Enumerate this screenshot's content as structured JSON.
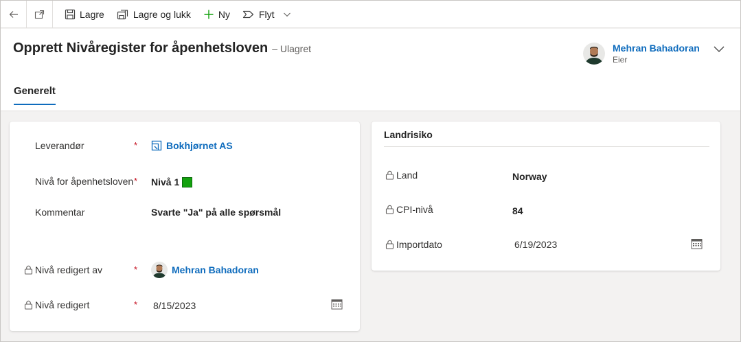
{
  "toolbar": {
    "save_label": "Lagre",
    "save_close_label": "Lagre og lukk",
    "new_label": "Ny",
    "flow_label": "Flyt"
  },
  "header": {
    "title": "Opprett Nivåregister for åpenhetsloven",
    "status": "– Ulagret",
    "owner_name": "Mehran Bahadoran",
    "owner_role": "Eier"
  },
  "tabs": [
    {
      "label": "Generelt",
      "active": true
    }
  ],
  "general": {
    "supplier_label": "Leverandør",
    "supplier_value": "Bokhjørnet AS",
    "level_label": "Nivå for åpenhetsloven",
    "level_value": "Nivå 1",
    "level_color": "#13a10e",
    "comment_label": "Kommentar",
    "comment_value": "Svarte \"Ja\" på alle spørsmål",
    "edited_by_label": "Nivå redigert av",
    "edited_by_value": "Mehran Bahadoran",
    "edited_label": "Nivå redigert",
    "edited_value": "8/15/2023",
    "required_mark": "*"
  },
  "country_risk": {
    "title": "Landrisiko",
    "country_label": "Land",
    "country_value": "Norway",
    "cpi_label": "CPI-nivå",
    "cpi_value": "84",
    "import_label": "Importdato",
    "import_value": "6/19/2023"
  },
  "colors": {
    "accent": "#0f6cbd",
    "required": "#c50f1f",
    "level_green": "#13a10e"
  }
}
